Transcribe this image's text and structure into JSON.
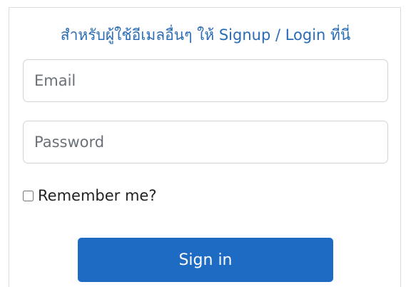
{
  "login": {
    "heading": "สำหรับผู้ใช้อีเมลอื่นๆ ให้ Signup / Login ที่นี่",
    "email_placeholder": "Email",
    "password_placeholder": "Password",
    "remember_label": "Remember me?",
    "signin_label": "Sign in"
  }
}
